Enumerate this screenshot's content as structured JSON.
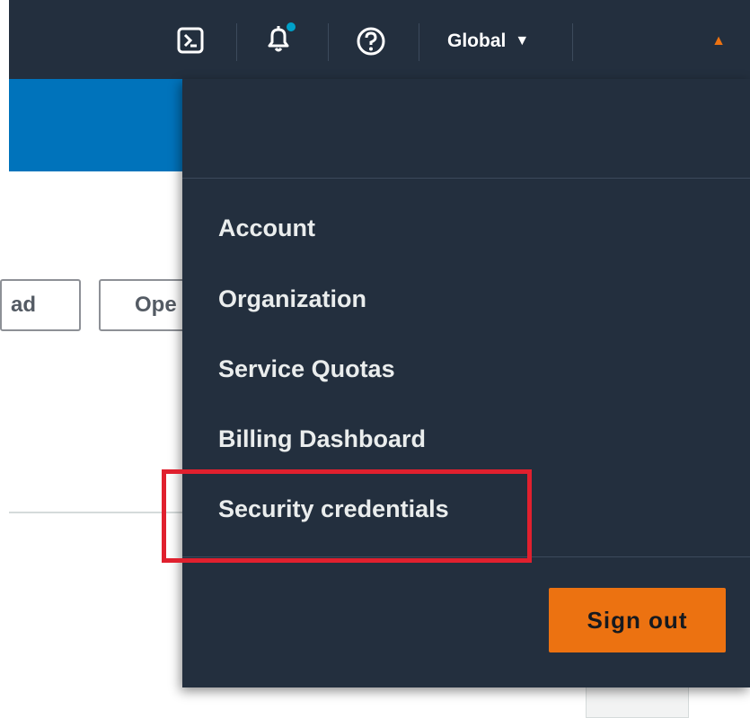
{
  "topbar": {
    "icons": [
      "cloudshell-icon",
      "bell-icon",
      "help-icon"
    ],
    "notification_dot_color": "#00a1c9",
    "region_label": "Global",
    "region_caret": "▼",
    "account_caret": "▲",
    "account_caret_color": "#ec7211"
  },
  "background_page": {
    "button_1_fragment": "ad",
    "button_2_fragment": "Ope"
  },
  "account_menu": {
    "items": [
      {
        "label": "Account"
      },
      {
        "label": "Organization"
      },
      {
        "label": "Service Quotas"
      },
      {
        "label": "Billing Dashboard"
      },
      {
        "label": "Security credentials"
      }
    ],
    "highlighted_item": "Security credentials",
    "highlight_color": "#e0202e",
    "sign_out_label": "Sign out",
    "sign_out_color": "#ec7211"
  },
  "colors": {
    "nav_background": "#232f3e",
    "banner_blue": "#0073bb"
  }
}
